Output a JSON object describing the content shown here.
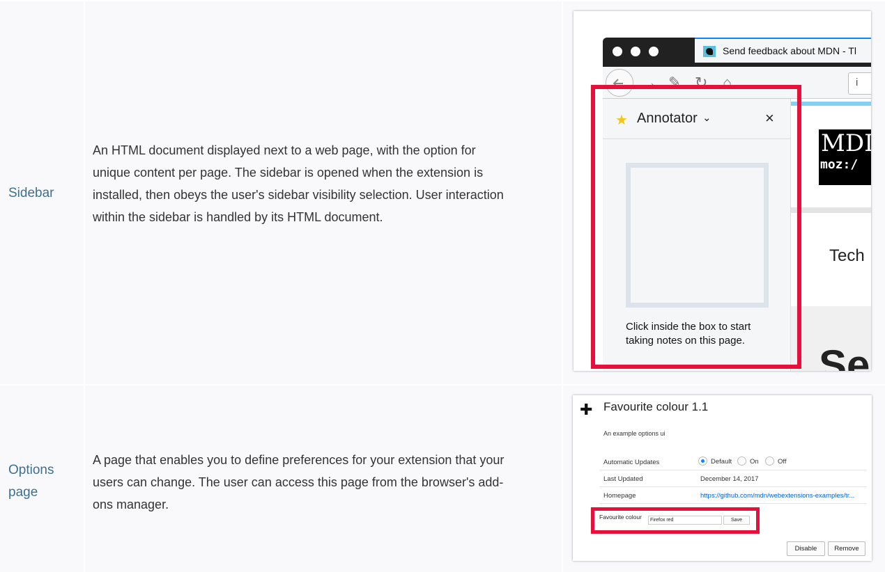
{
  "rows": [
    {
      "name": "Sidebar",
      "description": [
        "An HTML document displayed next to a web page, with the option for",
        "unique content per page. The sidebar is opened when the extension is",
        "installed, then obeys the user's sidebar visibility selection. User interaction",
        "within the sidebar is handled by its HTML document."
      ]
    },
    {
      "name_lines": [
        "Options",
        "page"
      ],
      "description": [
        "A page that enables you to define preferences for your extension that your",
        "users can change. The user can access this page from the browser's add-",
        "ons manager."
      ]
    }
  ],
  "sidebar_shot": {
    "tab_title": "Send feedback about MDN - Tl",
    "info_icon": "i",
    "sidebar_title": "Annotator",
    "close": "×",
    "hint": "Click inside the box to start taking notes on this page.",
    "page_mdn": "MDI",
    "page_moz": "moz:/",
    "page_tech": "Tech",
    "page_big": "Se",
    "highlight_color": "#e6103a"
  },
  "options_shot": {
    "title": "Favourite colour  1.1",
    "subtitle": "An example options ui",
    "rows": [
      {
        "label": "Automatic Updates",
        "options": [
          "Default",
          "On",
          "Off"
        ],
        "selected": "Default"
      },
      {
        "label": "Last Updated",
        "value": "December 14, 2017"
      },
      {
        "label": "Homepage",
        "value": "https://github.com/mdn/webextensions-examples/tr..."
      }
    ],
    "fav_label": "Favourite colour",
    "fav_value": "Firefox red",
    "save": "Save",
    "disable": "Disable",
    "remove": "Remove"
  }
}
